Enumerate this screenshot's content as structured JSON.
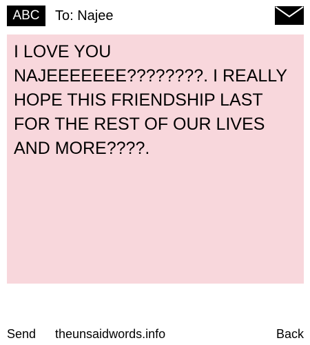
{
  "header": {
    "mode_label": "ABC",
    "recipient": "To: Najee",
    "envelope_icon": "envelope-icon"
  },
  "message": {
    "text": "I LOVE YOU NAJEEEEEEE????????. I REALLY HOPE THIS FRIENDSHIP LAST FOR THE REST OF OUR LIVES AND MORE????.",
    "background_color": "#f8d7dc"
  },
  "footer": {
    "send_label": "Send",
    "site_label": "theunsaidwords.info",
    "back_label": "Back"
  }
}
